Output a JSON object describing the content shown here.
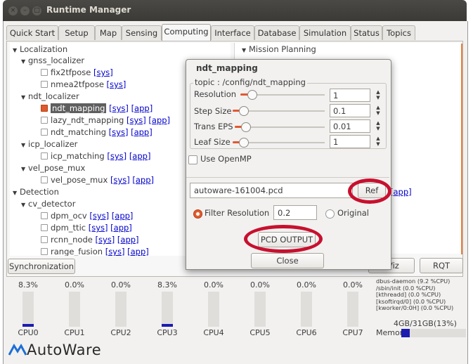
{
  "window": {
    "title": "Runtime Manager"
  },
  "tabs": [
    "Quick Start",
    "Setup",
    "Map",
    "Sensing",
    "Computing",
    "Interface",
    "Database",
    "Simulation",
    "Status",
    "Topics"
  ],
  "active_tab": "Computing",
  "tree": {
    "localization": "Localization",
    "gnss_localizer": "gnss_localizer",
    "fix2tfpose": "fix2tfpose",
    "nmea2tfpose": "nmea2tfpose",
    "ndt_localizer": "ndt_localizer",
    "ndt_mapping": "ndt_mapping",
    "lazy_ndt_mapping": "lazy_ndt_mapping",
    "ndt_matching": "ndt_matching",
    "icp_localizer": "icp_localizer",
    "icp_matching": "icp_matching",
    "vel_pose_mux": "vel_pose_mux",
    "vel_pose_mux_node": "vel_pose_mux",
    "detection": "Detection",
    "cv_detector": "cv_detector",
    "dpm_ocv": "dpm_ocv",
    "dpm_ttic": "dpm_ttic",
    "rcnn_node": "rcnn_node",
    "range_fusion": "range_fusion",
    "sys": "[sys]",
    "app": "[app]"
  },
  "right_tree": {
    "mission_planning": "Mission Planning"
  },
  "buttons": {
    "synchronization": "Synchronization",
    "viz": "Viz",
    "rqt": "RQT"
  },
  "dialog": {
    "title": "ndt_mapping",
    "topic": "topic : /config/ndt_mapping",
    "params": [
      {
        "label": "Resolution",
        "value": "1",
        "level": 0.15
      },
      {
        "label": "Step Size",
        "value": "0.1",
        "level": 0.1
      },
      {
        "label": "Trans EPS",
        "value": "0.01",
        "level": 0.1
      },
      {
        "label": "Leaf Size",
        "value": "1",
        "level": 0.1
      }
    ],
    "openmp_label": "Use OpenMP",
    "pcd_filename": "autoware-161004.pcd",
    "ref_label": "Ref",
    "filter_resolution_label": "Filter Resolution",
    "filter_resolution_value": "0.2",
    "original_label": "Original",
    "pcd_output_label": "PCD OUTPUT",
    "close_label": "Close",
    "behind_app": "[app]"
  },
  "cpu": [
    {
      "label": "CPU0",
      "pct": "8.3%",
      "level": 0.083
    },
    {
      "label": "CPU1",
      "pct": "0.0%",
      "level": 0
    },
    {
      "label": "CPU2",
      "pct": "0.0%",
      "level": 0
    },
    {
      "label": "CPU3",
      "pct": "8.3%",
      "level": 0.083
    },
    {
      "label": "CPU4",
      "pct": "0.0%",
      "level": 0
    },
    {
      "label": "CPU5",
      "pct": "0.0%",
      "level": 0
    },
    {
      "label": "CPU6",
      "pct": "0.0%",
      "level": 0
    },
    {
      "label": "CPU7",
      "pct": "0.0%",
      "level": 0
    }
  ],
  "processes": [
    "dbus-daemon (9.2 %CPU)",
    "/sbin/init (0.0 %CPU)",
    "[kthreadd] (0.0 %CPU)",
    "[ksoftirqd/0] (0.0 %CPU)",
    "[kworker/0:0H] (0.0 %CPU)"
  ],
  "memory": {
    "text": "4GB/31GB(13%)",
    "label": "Memory",
    "level": 0.13
  },
  "logo": {
    "text": "AutoWare"
  },
  "colors": {
    "accent": "#e4572e",
    "highlight_ring": "#c8102e",
    "bar": "#1b1bb0"
  }
}
